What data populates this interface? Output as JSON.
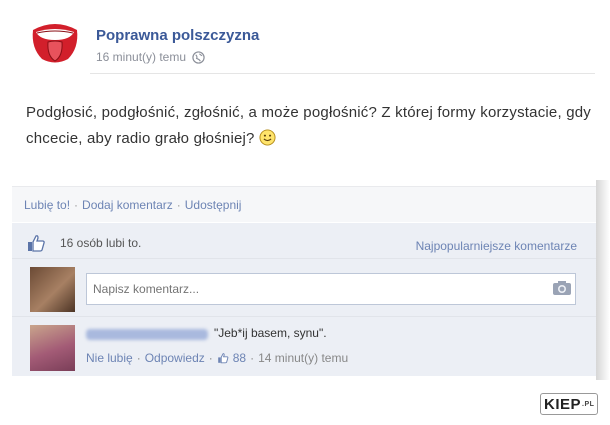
{
  "post": {
    "page_name": "Poprawna polszczyzna",
    "time": "16 minut(y) temu",
    "message": "Podgłosić, podgłośnić, zgłośnić, a może pogłośnić? Z której formy korzystacie, gdy chcecie, aby radio grało głośniej?"
  },
  "actions": {
    "like": "Lubię to!",
    "comment": "Dodaj komentarz",
    "share": "Udostępnij",
    "sep": "·"
  },
  "likes": {
    "text": "16 osób lubi to.",
    "top_comments": "Najpopularniejsze komentarze"
  },
  "comment_box": {
    "placeholder": "Napisz komentarz..."
  },
  "comment": {
    "text": "\"Jeb*ij basem, synu\".",
    "unlike": "Nie lubię",
    "reply": "Odpowiedz",
    "like_count": "88",
    "time": "14 minut(y) temu"
  },
  "watermark": {
    "brand": "KIEP",
    "tld": ".PL"
  },
  "colors": {
    "link": "#6d84b4",
    "page_name": "#3b5998",
    "logo_red": "#d21f2b"
  }
}
